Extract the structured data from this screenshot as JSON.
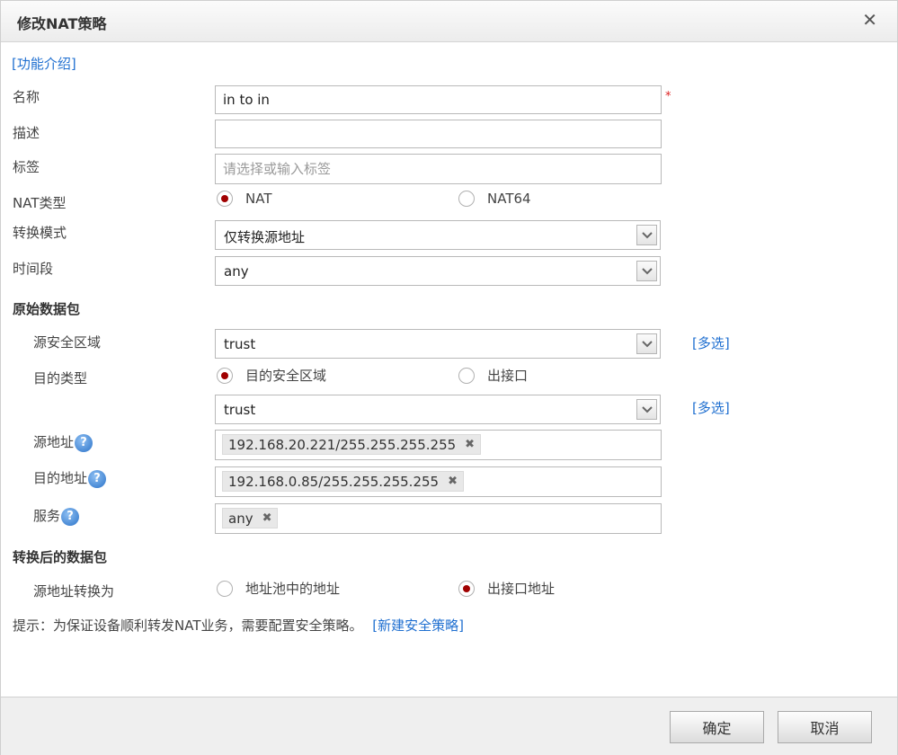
{
  "dialog": {
    "title": "修改NAT策略",
    "close_glyph": "✕",
    "intro_link": "[功能介绍]"
  },
  "fields": {
    "name": {
      "label": "名称",
      "value": "in to in",
      "required_mark": "*"
    },
    "description": {
      "label": "描述",
      "value": ""
    },
    "tags": {
      "label": "标签",
      "placeholder": "请选择或输入标签"
    },
    "nat_type": {
      "label": "NAT类型",
      "options": [
        "NAT",
        "NAT64"
      ],
      "selected": "NAT"
    },
    "convert_mode": {
      "label": "转换模式",
      "value": "仅转换源地址"
    },
    "time_range": {
      "label": "时间段",
      "value": "any"
    }
  },
  "original_packet": {
    "heading": "原始数据包",
    "source_zone": {
      "label": "源安全区域",
      "value": "trust",
      "multi_link": "[多选]"
    },
    "dest_type": {
      "label": "目的类型",
      "options": [
        "目的安全区域",
        "出接口"
      ],
      "selected": "目的安全区域"
    },
    "dest_zone": {
      "value": "trust",
      "multi_link": "[多选]"
    },
    "source_address": {
      "label": "源地址",
      "tag": "192.168.20.221/255.255.255.255"
    },
    "dest_address": {
      "label": "目的地址",
      "tag": "192.168.0.85/255.255.255.255"
    },
    "service": {
      "label": "服务",
      "tag": "any"
    }
  },
  "translated_packet": {
    "heading": "转换后的数据包",
    "source_translate": {
      "label": "源地址转换为",
      "options": [
        "地址池中的地址",
        "出接口地址"
      ],
      "selected": "出接口地址"
    }
  },
  "hint": {
    "text": "提示：为保证设备顺利转发NAT业务，需要配置安全策略。",
    "link": "[新建安全策略]"
  },
  "footer": {
    "ok_label": "确定",
    "cancel_label": "取消"
  },
  "icons": {
    "help": "?",
    "tag_remove": "✖"
  },
  "colors": {
    "link": "#1f6fd0",
    "radio_selected": "#a00000",
    "required": "#dd2222"
  }
}
